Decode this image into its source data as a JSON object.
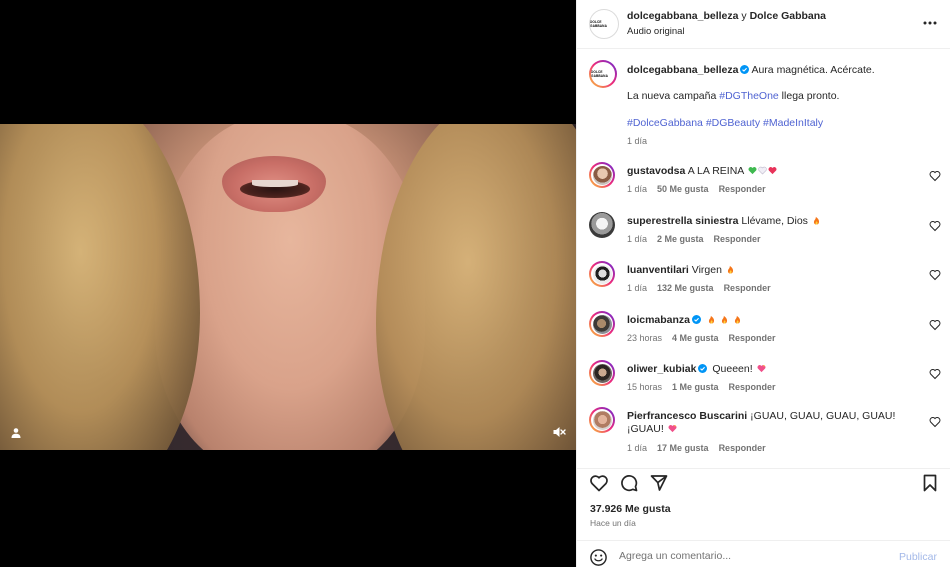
{
  "header": {
    "account": "dolcegabbana_belleza",
    "joiner": " y ",
    "coauthor": "Dolce Gabbana",
    "audio": "Audio original",
    "brand_mark": "DOLCE GABBANA"
  },
  "caption": {
    "username": "dolcegabbana_belleza",
    "text1": "Aura magnética. Acércate.",
    "line2_pre": "La nueva campaña ",
    "line2_tag": "#DGTheOne",
    "line2_post": " llega pronto.",
    "hashtags": [
      "#DolceGabbana",
      "#DGBeauty",
      "#MadeInItaly"
    ],
    "time": "1 día"
  },
  "comments": [
    {
      "user": "gustavodsa",
      "verified": false,
      "text": "A LA REINA",
      "time": "1 día",
      "likes": "50 Me gusta",
      "reply": "Responder"
    },
    {
      "user": "superestrella siniestra",
      "verified": false,
      "text": "Llévame, Dios",
      "time": "1 día",
      "likes": "2 Me gusta",
      "reply": "Responder"
    },
    {
      "user": "luanventilari",
      "verified": false,
      "text": "Virgen",
      "time": "1 día",
      "likes": "132 Me gusta",
      "reply": "Responder"
    },
    {
      "user": "loicmabanza",
      "verified": true,
      "text": "",
      "time": "23 horas",
      "likes": "4 Me gusta",
      "reply": "Responder"
    },
    {
      "user": "oliwer_kubiak",
      "verified": true,
      "text": "Queeen!",
      "time": "15 horas",
      "likes": "1 Me gusta",
      "reply": "Responder"
    },
    {
      "user": "Pierfrancesco Buscarini",
      "verified": false,
      "text": "¡GUAU, GUAU, GUAU, GUAU! ¡GUAU!",
      "time": "1 día",
      "likes": "17 Me gusta",
      "reply": "Responder"
    }
  ],
  "stats": {
    "likes": "37.926 Me gusta",
    "posted": "Hace un día"
  },
  "composer": {
    "placeholder": "Agrega un comentario...",
    "publish": "Publicar"
  },
  "icons": {
    "user_tag": "user-icon",
    "mute": "speaker-muted-icon",
    "more": "more-horizontal-icon",
    "like": "heart-icon",
    "comment": "comment-icon",
    "share": "send-icon",
    "save": "bookmark-icon",
    "emoji": "smile-icon"
  },
  "colors": {
    "verified": "#0095f6",
    "hashtag": "#4f63d2",
    "publish": "#a3b8e8",
    "muted_text": "#737373"
  }
}
